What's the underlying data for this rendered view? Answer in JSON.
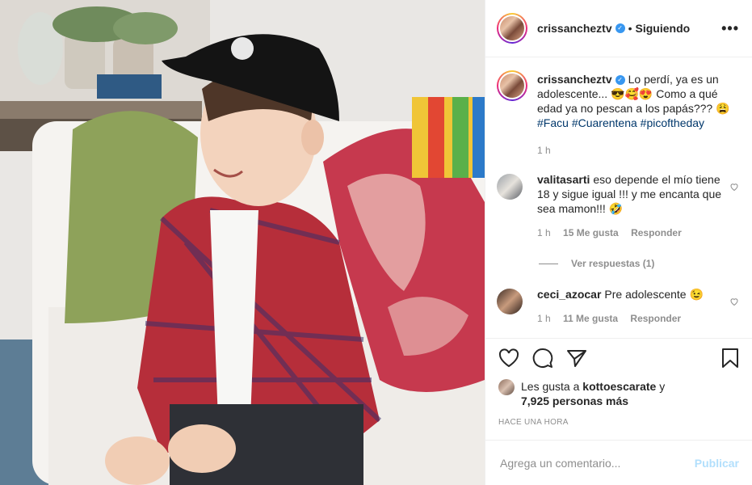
{
  "post": {
    "username": "crissancheztv",
    "verified_icon": "verified-badge-icon",
    "separator": "•",
    "follow_status": "Siguiendo",
    "more_icon": "more-options-icon"
  },
  "caption": {
    "username": "crissancheztv",
    "text_1": "Lo perdí, ya es un adolescente... ",
    "emojis_1": "😎🥰😍",
    "text_2": " Como a qué edad ya no pescan a los papás??? ",
    "emoji_2": "😩",
    "hashtags": [
      "#Facu",
      "#Cuarentena",
      "#picoftheday"
    ],
    "time": "1 h"
  },
  "comments": [
    {
      "username": "valitasarti",
      "text": "eso depende el mío tiene 18 y sigue igual !!! y me encanta que sea mamon!!! 🤣",
      "time": "1 h",
      "likes": "15 Me gusta",
      "reply": "Responder",
      "view_replies": "Ver respuestas (1)"
    },
    {
      "username": "ceci_azocar",
      "text": "Pre adolescente 😉",
      "time": "1 h",
      "likes": "11 Me gusta",
      "reply": "Responder"
    }
  ],
  "actions": {
    "like_icon": "heart-icon",
    "comment_icon": "comment-icon",
    "share_icon": "share-icon",
    "save_icon": "bookmark-icon"
  },
  "likes": {
    "prefix": "Les gusta a ",
    "user": "kottoescarate",
    "middle": " y",
    "others": "7,925 personas más"
  },
  "timestamp": "Hace una hora",
  "add_comment": {
    "placeholder": "Agrega un comentario...",
    "post_label": "Publicar"
  },
  "colors": {
    "accent": "#3897f0",
    "link": "#00376b",
    "muted": "#8e8e8e",
    "post_disabled": "#b2dffc"
  }
}
